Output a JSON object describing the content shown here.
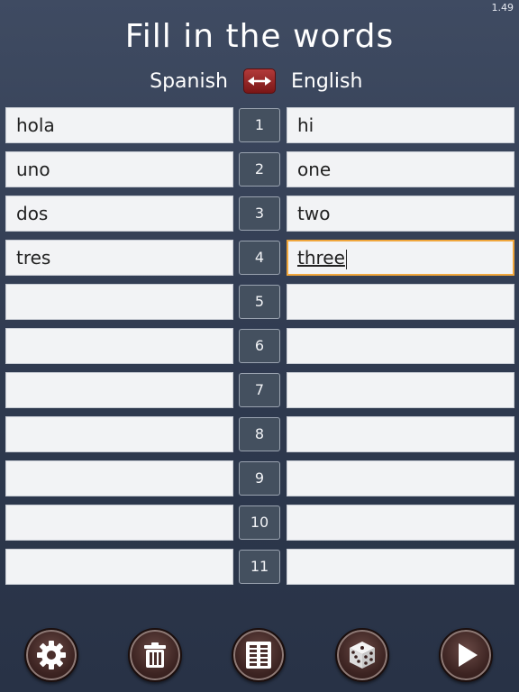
{
  "status": {
    "version": "1.49"
  },
  "header": {
    "title": "Fill in the words",
    "lang_left": "Spanish",
    "lang_right": "English"
  },
  "rows": [
    {
      "num": "1",
      "left": "hola",
      "right": "hi"
    },
    {
      "num": "2",
      "left": "uno",
      "right": "one"
    },
    {
      "num": "3",
      "left": "dos",
      "right": "two"
    },
    {
      "num": "4",
      "left": "tres",
      "right": "three"
    },
    {
      "num": "5",
      "left": "",
      "right": ""
    },
    {
      "num": "6",
      "left": "",
      "right": ""
    },
    {
      "num": "7",
      "left": "",
      "right": ""
    },
    {
      "num": "8",
      "left": "",
      "right": ""
    },
    {
      "num": "9",
      "left": "",
      "right": ""
    },
    {
      "num": "10",
      "left": "",
      "right": ""
    },
    {
      "num": "11",
      "left": "",
      "right": ""
    }
  ],
  "active_field": "rows.3.right",
  "toolbar": {
    "buttons": [
      {
        "icon": "gear-icon"
      },
      {
        "icon": "trash-icon"
      },
      {
        "icon": "list-icon"
      },
      {
        "icon": "dice-icon"
      },
      {
        "icon": "play-icon"
      }
    ]
  },
  "colors": {
    "accent_focus": "#f0a63c",
    "swap_button": "#9a2a2a",
    "toolbar_button": "#4a2e2b"
  }
}
